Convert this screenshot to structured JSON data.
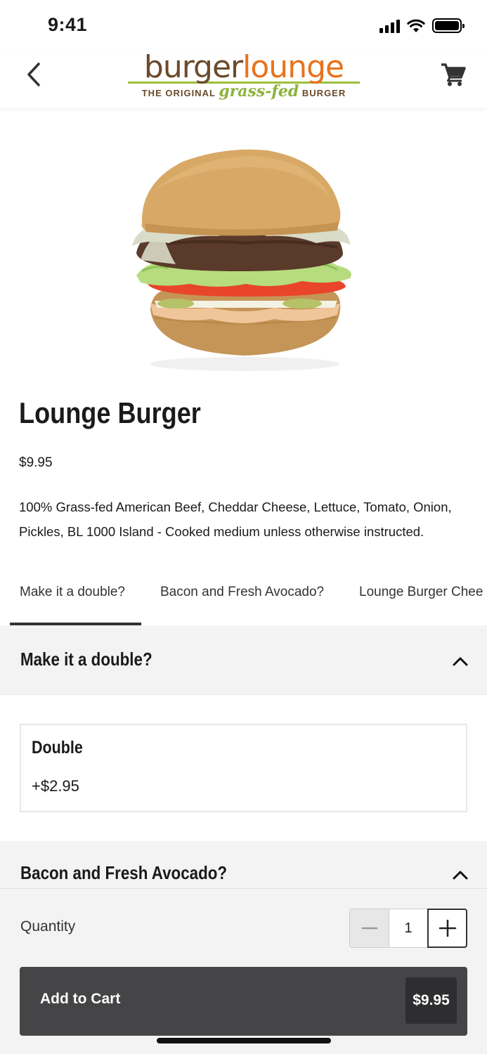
{
  "status_bar": {
    "time": "9:41"
  },
  "header": {
    "logo": {
      "word1": "burger",
      "word2": "lounge",
      "sub_prefix": "THE ORIGINAL",
      "sub_highlight": "grass-fed",
      "sub_suffix": "BURGER"
    },
    "back_icon": "chevron-left-icon",
    "cart_icon": "cart-icon"
  },
  "product": {
    "title": "Lounge Burger",
    "price": "$9.95",
    "description": "100% Grass-fed American Beef, Cheddar Cheese, Lettuce, Tomato, Onion, Pickles, BL 1000 Island - Cooked medium unless otherwise instructed."
  },
  "tabs": [
    {
      "label": "Make it a double?",
      "active": true
    },
    {
      "label": "Bacon and Fresh Avocado?",
      "active": false
    },
    {
      "label": "Lounge Burger Chee",
      "active": false
    }
  ],
  "sections": [
    {
      "title": "Make it a double?",
      "expanded": true,
      "options": [
        {
          "name": "Double",
          "price": "+$2.95"
        }
      ]
    },
    {
      "title": "Bacon and Fresh Avocado?",
      "expanded": true
    }
  ],
  "footer": {
    "quantity_label": "Quantity",
    "quantity_value": "1",
    "add_to_cart_label": "Add to Cart",
    "add_to_cart_price": "$9.95"
  },
  "colors": {
    "brand_brown": "#6b4a2b",
    "brand_orange": "#e8731d",
    "brand_green": "#8cb33a",
    "button_dark": "#454547"
  }
}
